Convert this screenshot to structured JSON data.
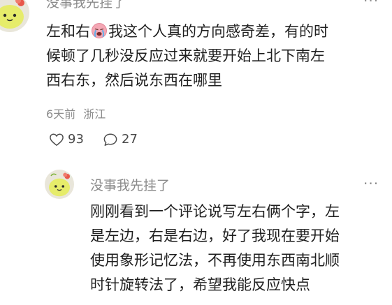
{
  "comment": {
    "author": "没事我先挂了",
    "more_label": "···",
    "text_line1_a": "左和右",
    "emoji_icon": "crying-face-icon",
    "text_line1_b": "我这个人真的方向感奇差，有的时",
    "text_line2": "候顿了几秒没反应过来就要开始上北下南左",
    "text_line3": "西右东，然后说东西在哪里",
    "time": "6天前",
    "location": "浙江",
    "like_count": "93",
    "reply_count": "27"
  },
  "reply": {
    "author": "没事我先挂了",
    "more_label": "···",
    "text_line1": "刚刚看到一个评论说写左右俩个字，左",
    "text_line2": "是左边，右是右边，好了我现在要开始",
    "text_line3": "使用象形记忆法，不再使用东西南北顺",
    "text_line4": "时针旋转法了，希望我能反应快点"
  },
  "colors": {
    "avatar_bg": "#e9e6da",
    "avatar_face": "#e6ec6a",
    "avatar_flower": "#e8574a",
    "muted_text": "#8a8a8a"
  }
}
